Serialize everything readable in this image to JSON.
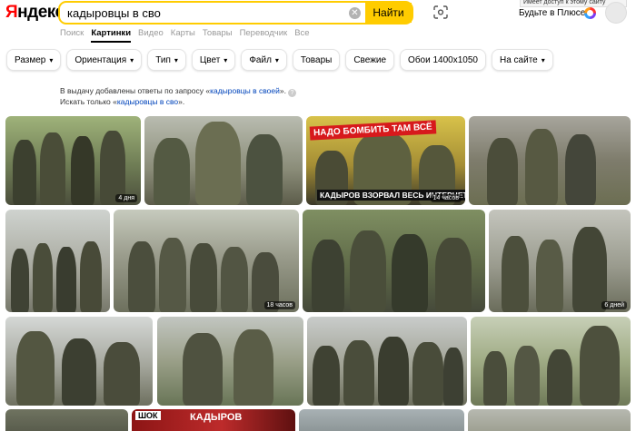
{
  "header": {
    "logo_first": "Я",
    "logo_rest": "ндекс",
    "search_value": "кадыровцы в сво",
    "search_button": "Найти",
    "tooltip": "Имеет доступ к этому сайту",
    "plus_label": "Будьте в Плюсе"
  },
  "services": [
    "Поиск",
    "Картинки",
    "Видео",
    "Карты",
    "Товары",
    "Переводчик",
    "Все"
  ],
  "filters": [
    {
      "label": "Размер",
      "dropdown": true
    },
    {
      "label": "Ориентация",
      "dropdown": true
    },
    {
      "label": "Тип",
      "dropdown": true
    },
    {
      "label": "Цвет",
      "dropdown": true
    },
    {
      "label": "Файл",
      "dropdown": true
    },
    {
      "label": "Товары",
      "dropdown": false
    },
    {
      "label": "Свежие",
      "dropdown": false
    },
    {
      "label": "Обои 1400x1050",
      "dropdown": false
    },
    {
      "label": "На сайте",
      "dropdown": true
    }
  ],
  "notice": {
    "line1_prefix": "В выдачу добавлены ответы по запросу «",
    "line1_link": "кадыровцы в своей",
    "line1_suffix": "».",
    "line2_prefix": "Искать только «",
    "line2_link": "кадыровцы в сво",
    "line2_suffix": "»."
  },
  "results": {
    "badges": {
      "r1c1": "4 дня",
      "r1c3": "14 часов",
      "r2c2": "18 часов",
      "r2c4": "6 дней"
    },
    "banner_top": "НАДО БОМБИТЬ ТАМ ВСЁ",
    "banner_bottom": "КАДЫРОВ ВЗОРВАЛ ВЕСЬ ИНТЕРНЕТ",
    "banner_shok": "ШОК",
    "banner_kadyrov": "КАДЫРОВ"
  },
  "colors": {
    "accent": "#ffcc00",
    "logo_red": "#ff0000",
    "link": "#0044bb",
    "banner_red": "#d7191c"
  }
}
